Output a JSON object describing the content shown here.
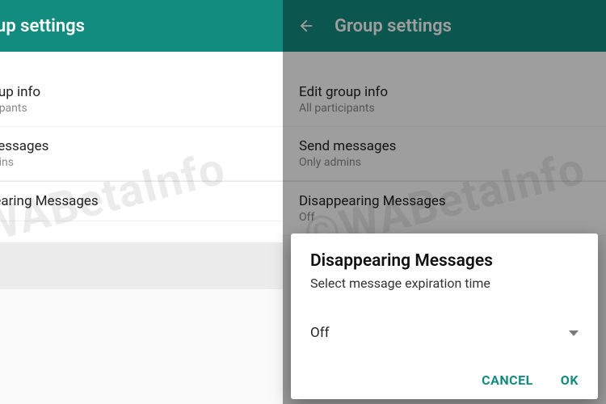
{
  "watermark": "©WABetaInfo",
  "left": {
    "header_title": "Group settings",
    "rows": [
      {
        "label": "Edit group info",
        "sub": "All participants"
      },
      {
        "label": "Send messages",
        "sub": "Only admins"
      },
      {
        "label": "Disappearing Messages",
        "sub": ""
      }
    ]
  },
  "right": {
    "header_title": "Group settings",
    "rows": [
      {
        "label": "Edit group info",
        "sub": "All participants"
      },
      {
        "label": "Send messages",
        "sub": "Only admins"
      },
      {
        "label": "Disappearing Messages",
        "sub": "Off"
      }
    ],
    "dialog": {
      "title": "Disappearing Messages",
      "subtitle": "Select message expiration time",
      "selected": "Off",
      "cancel": "Cancel",
      "ok": "OK"
    }
  }
}
